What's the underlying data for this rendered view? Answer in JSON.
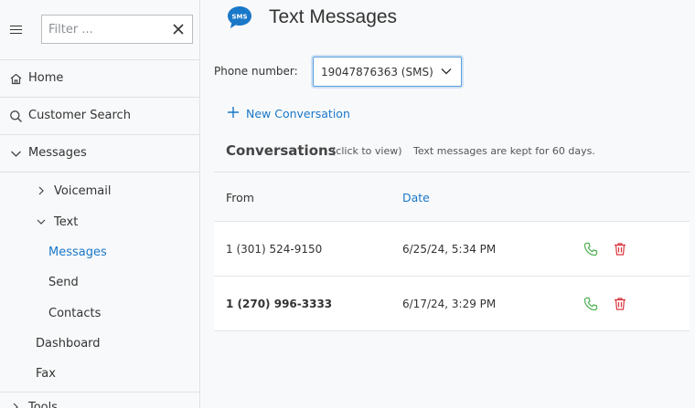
{
  "sidebar": {
    "filter_placeholder": "Filter ...",
    "nav": [
      {
        "label": "Home",
        "icon": "home-icon"
      },
      {
        "label": "Customer Search",
        "icon": "search-icon"
      },
      {
        "label": "Messages",
        "icon": "chevron-down-icon"
      }
    ],
    "messages_children": {
      "voicemail": "Voicemail",
      "text": "Text",
      "text_children": {
        "messages": "Messages",
        "send": "Send",
        "contacts": "Contacts"
      },
      "dashboard": "Dashboard",
      "fax": "Fax"
    },
    "partial_next_label": "Tools"
  },
  "main": {
    "title": "Text Messages",
    "sms_badge": "SMS",
    "phone_label": "Phone number:",
    "phone_selected": "19047876363 (SMS)",
    "new_conversation": "New Conversation",
    "conversations_heading": "Conversations",
    "click_hint": "(click to view)",
    "retention_note": "Text messages are kept for 60 days.",
    "table": {
      "columns": {
        "from": "From",
        "date": "Date"
      },
      "rows": [
        {
          "from": "1 (301) 524-9150",
          "date": "6/25/24, 5:34 PM",
          "unread": false
        },
        {
          "from": "1 (270) 996-3333",
          "date": "6/17/24, 3:29 PM",
          "unread": true
        }
      ]
    }
  },
  "colors": {
    "accent": "#1a78c8",
    "call_green": "#4caf50",
    "delete_red": "#d9363e"
  }
}
